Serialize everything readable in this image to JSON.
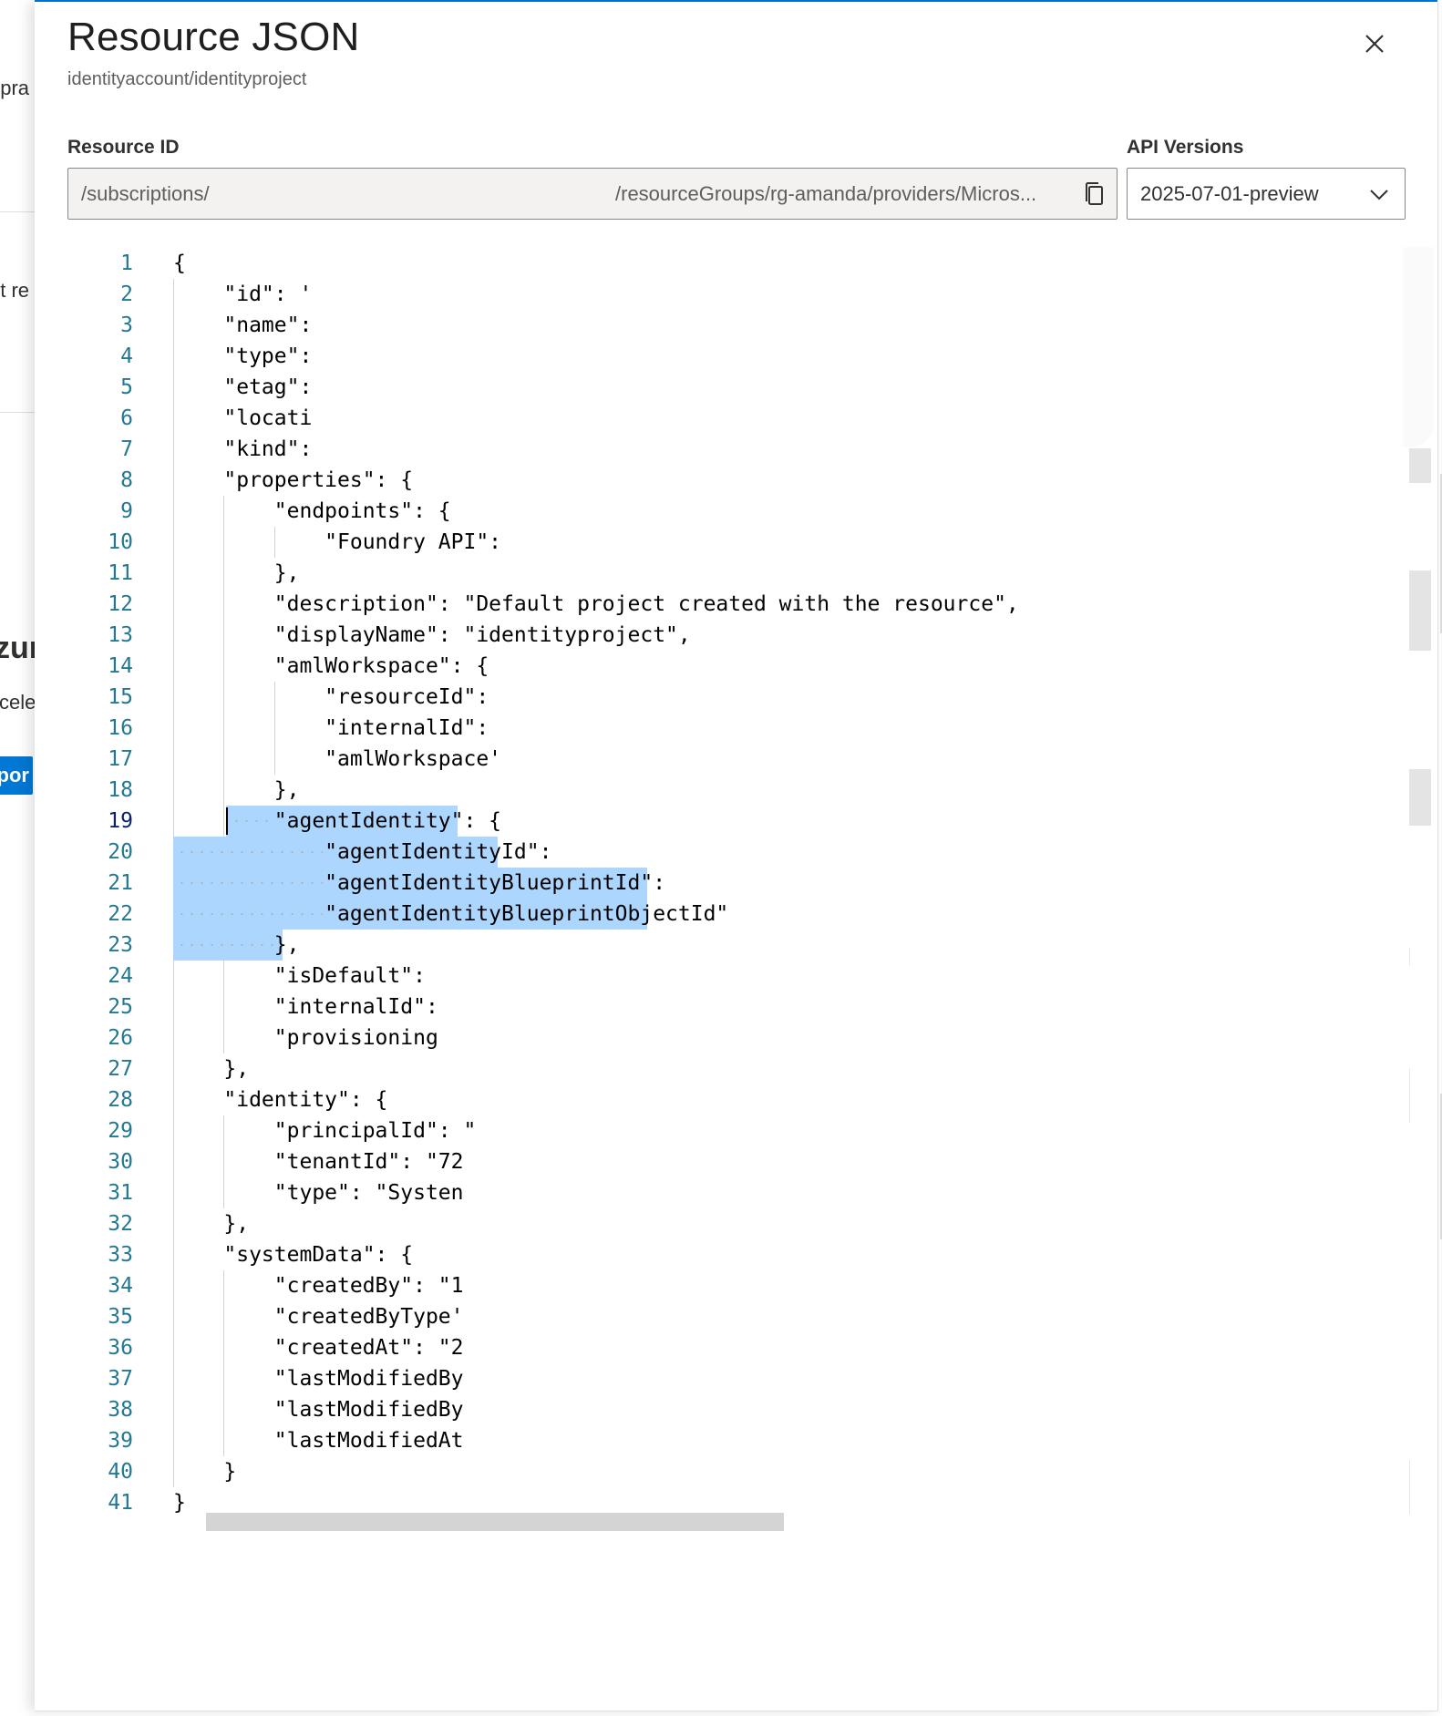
{
  "panel": {
    "title": "Resource JSON",
    "subtitle": "identityaccount/identityproject",
    "close_label": "Close"
  },
  "resource_id": {
    "label": "Resource ID",
    "value_start": "/subscriptions/",
    "value_end": "/resourceGroups/rg-amanda/providers/Micros..."
  },
  "api_versions": {
    "label": "API Versions",
    "selected": "2025-07-01-preview"
  },
  "icons": {
    "close": "close-icon",
    "copy": "copy-icon",
    "chevron": "chevron-down-icon"
  },
  "background": {
    "text_1": "t pra",
    "text_2": "nt re",
    "title": "zur",
    "text_3": "ccele",
    "button": "por"
  },
  "editor": {
    "current_line": 19,
    "lines": [
      {
        "n": "1",
        "text": "{"
      },
      {
        "n": "2",
        "text": "    \"id\": '"
      },
      {
        "n": "3",
        "text": "    \"name\":"
      },
      {
        "n": "4",
        "text": "    \"type\":"
      },
      {
        "n": "5",
        "text": "    \"etag\":"
      },
      {
        "n": "6",
        "text": "    \"locati"
      },
      {
        "n": "7",
        "text": "    \"kind\":"
      },
      {
        "n": "8",
        "text": "    \"properties\": {"
      },
      {
        "n": "9",
        "text": "        \"endpoints\": {"
      },
      {
        "n": "10",
        "text": "            \"Foundry API\":"
      },
      {
        "n": "11",
        "text": "        },"
      },
      {
        "n": "12",
        "text": "        \"description\": \"Default project created with the resource\","
      },
      {
        "n": "13",
        "text": "        \"displayName\": \"identityproject\","
      },
      {
        "n": "14",
        "text": "        \"amlWorkspace\": {"
      },
      {
        "n": "15",
        "text": "            \"resourceId\":"
      },
      {
        "n": "16",
        "text": "            \"internalId\":"
      },
      {
        "n": "17",
        "text": "            \"amlWorkspace'"
      },
      {
        "n": "18",
        "text": "        },"
      },
      {
        "n": "19",
        "text": "        \"agentIdentity\": {"
      },
      {
        "n": "20",
        "text": "            \"agentIdentityId\":"
      },
      {
        "n": "21",
        "text": "            \"agentIdentityBlueprintId\":"
      },
      {
        "n": "22",
        "text": "            \"agentIdentityBlueprintObjectId\""
      },
      {
        "n": "23",
        "text": "        },"
      },
      {
        "n": "24",
        "text": "        \"isDefault\":"
      },
      {
        "n": "25",
        "text": "        \"internalId\":"
      },
      {
        "n": "26",
        "text": "        \"provisioning"
      },
      {
        "n": "27",
        "text": "    },"
      },
      {
        "n": "28",
        "text": "    \"identity\": {"
      },
      {
        "n": "29",
        "text": "        \"principalId\": \""
      },
      {
        "n": "30",
        "text": "        \"tenantId\": \"72"
      },
      {
        "n": "31",
        "text": "        \"type\": \"Systen"
      },
      {
        "n": "32",
        "text": "    },"
      },
      {
        "n": "33",
        "text": "    \"systemData\": {"
      },
      {
        "n": "34",
        "text": "        \"createdBy\": \"1"
      },
      {
        "n": "35",
        "text": "        \"createdByType'"
      },
      {
        "n": "36",
        "text": "        \"createdAt\": \"2"
      },
      {
        "n": "37",
        "text": "        \"lastModifiedBy"
      },
      {
        "n": "38",
        "text": "        \"lastModifiedBy"
      },
      {
        "n": "39",
        "text": "        \"lastModifiedAt"
      },
      {
        "n": "40",
        "text": "    }"
      },
      {
        "n": "41",
        "text": "}"
      }
    ]
  },
  "colors": {
    "accent": "#0078d4",
    "line_number": "#237893",
    "selection": "#add6ff"
  }
}
